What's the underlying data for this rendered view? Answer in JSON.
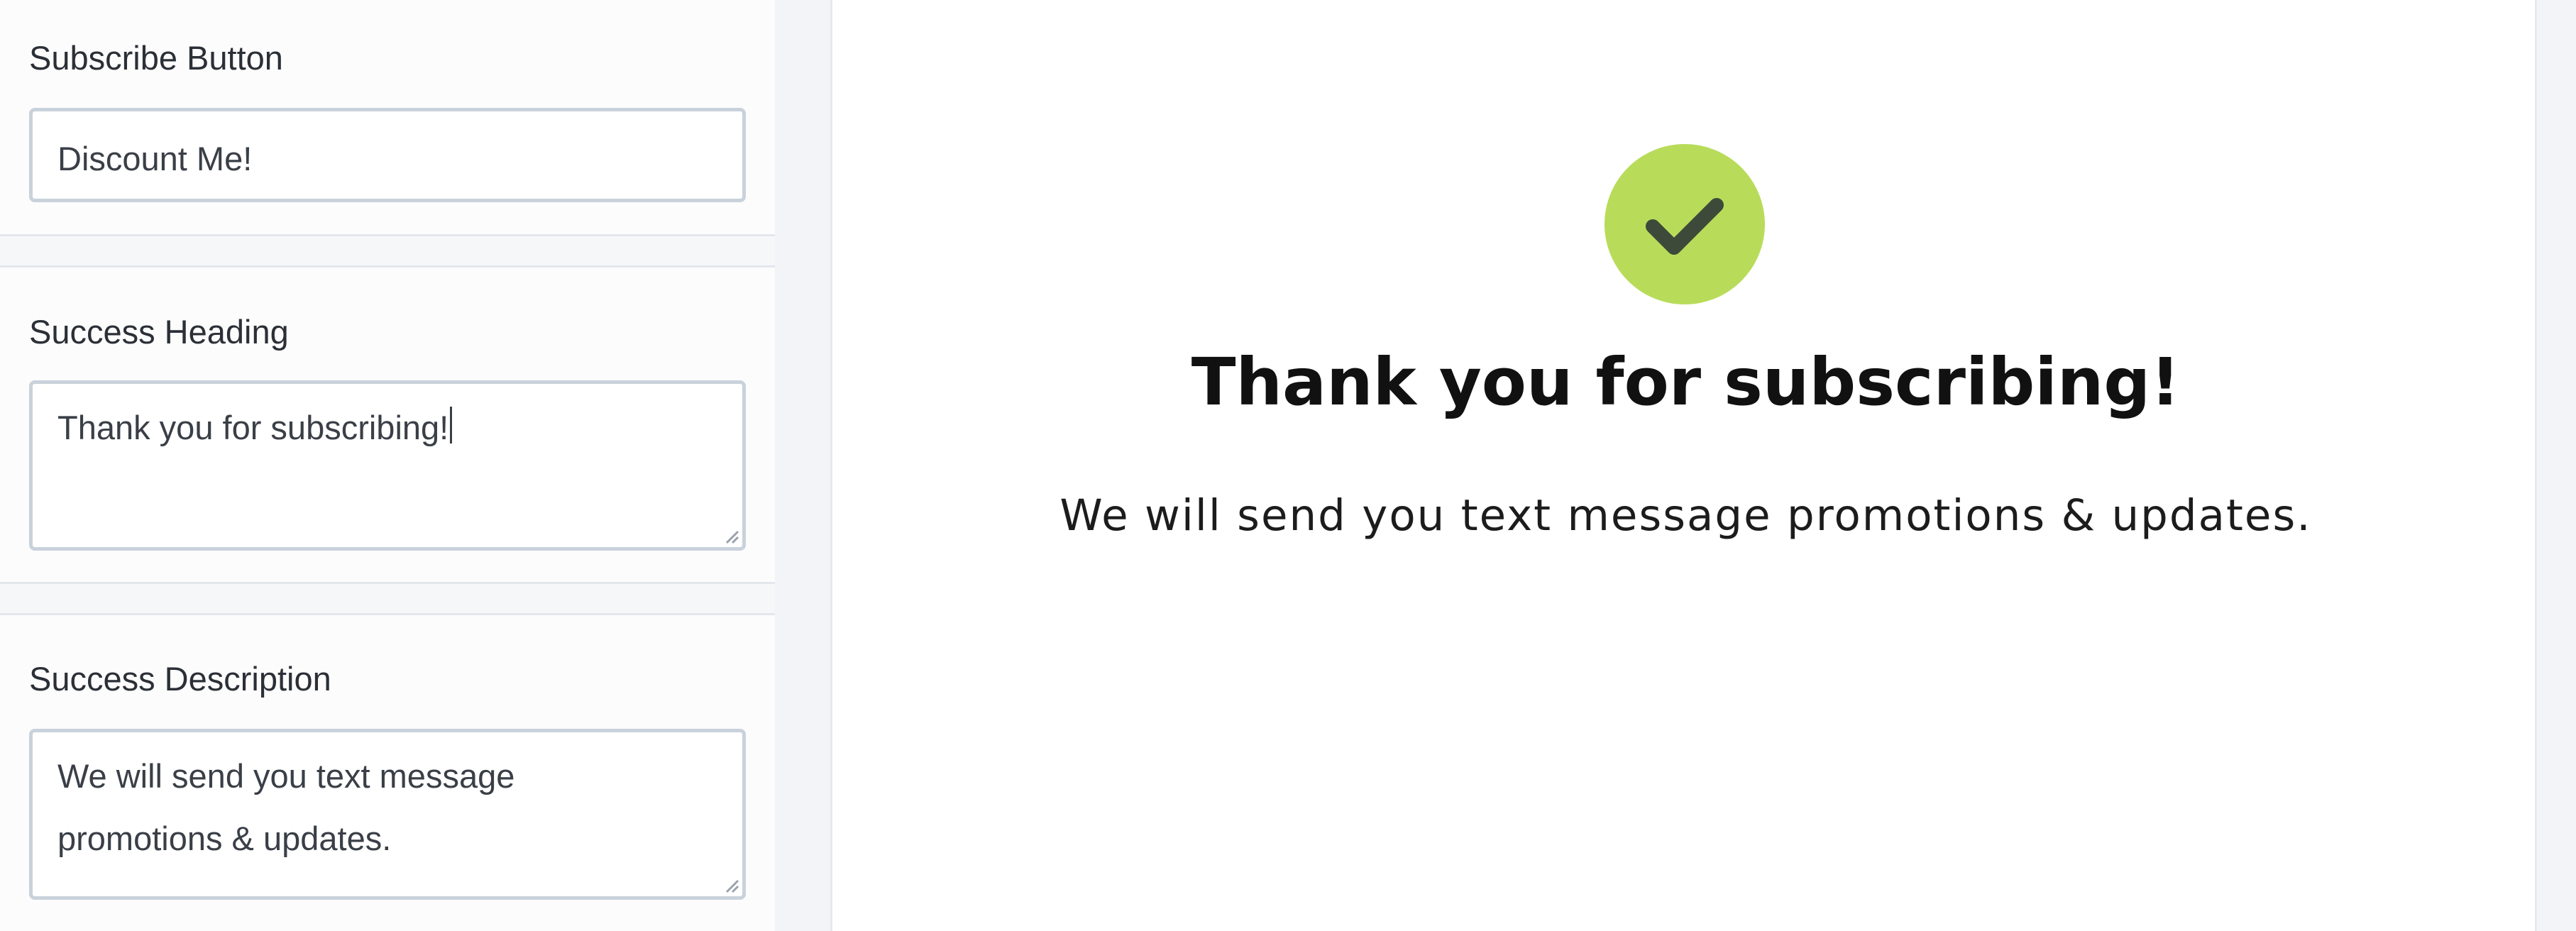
{
  "settings": {
    "subscribe_button": {
      "label": "Subscribe Button",
      "value": "Discount Me!"
    },
    "success_heading": {
      "label": "Success Heading",
      "value": "Thank you for subscribing!"
    },
    "success_description": {
      "label": "Success Description",
      "value": "We will send you text message promotions & updates."
    }
  },
  "preview": {
    "icon": "checkmark-icon",
    "badge_color": "#b8dc5a",
    "check_color": "#3d4a3a",
    "heading": "Thank you for subscribing!",
    "description": "We will send you text message promotions & updates."
  }
}
